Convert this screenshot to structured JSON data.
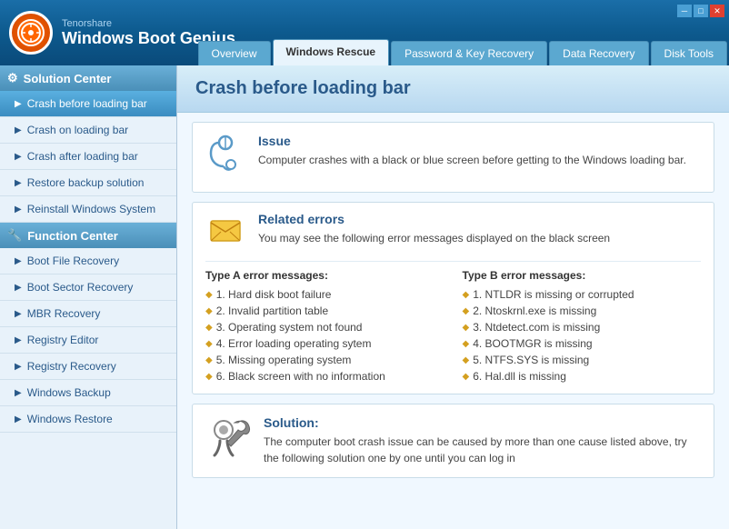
{
  "window": {
    "title": "Windows Boot Genius",
    "company": "Tenorshare",
    "min_btn": "─",
    "max_btn": "□",
    "close_btn": "✕"
  },
  "nav": {
    "tabs": [
      {
        "id": "overview",
        "label": "Overview",
        "active": false
      },
      {
        "id": "windows-rescue",
        "label": "Windows Rescue",
        "active": true
      },
      {
        "id": "password-key-recovery",
        "label": "Password & Key Recovery",
        "active": false
      },
      {
        "id": "data-recovery",
        "label": "Data Recovery",
        "active": false
      },
      {
        "id": "disk-tools",
        "label": "Disk Tools",
        "active": false
      }
    ]
  },
  "sidebar": {
    "solution_center": {
      "label": "Solution Center",
      "items": [
        {
          "id": "crash-before",
          "label": "Crash before loading bar",
          "active": true
        },
        {
          "id": "crash-on",
          "label": "Crash on loading bar",
          "active": false
        },
        {
          "id": "crash-after",
          "label": "Crash after loading bar",
          "active": false
        },
        {
          "id": "restore-backup",
          "label": "Restore backup solution",
          "active": false
        },
        {
          "id": "reinstall-windows",
          "label": "Reinstall Windows System",
          "active": false
        }
      ]
    },
    "function_center": {
      "label": "Function Center",
      "items": [
        {
          "id": "boot-file",
          "label": "Boot File Recovery",
          "active": false
        },
        {
          "id": "boot-sector",
          "label": "Boot Sector Recovery",
          "active": false
        },
        {
          "id": "mbr-recovery",
          "label": "MBR Recovery",
          "active": false
        },
        {
          "id": "registry-editor",
          "label": "Registry Editor",
          "active": false
        },
        {
          "id": "registry-recovery",
          "label": "Registry Recovery",
          "active": false
        },
        {
          "id": "windows-backup",
          "label": "Windows Backup",
          "active": false
        },
        {
          "id": "windows-restore",
          "label": "Windows Restore",
          "active": false
        }
      ]
    }
  },
  "content": {
    "title": "Crash before loading bar",
    "issue": {
      "heading": "Issue",
      "description": "Computer crashes with a black or blue screen before getting to the Windows loading bar."
    },
    "related_errors": {
      "heading": "Related errors",
      "description": "You may see the following error messages displayed on the black screen",
      "type_a": {
        "heading": "Type A error messages:",
        "items": [
          "1. Hard disk boot failure",
          "2. Invalid partition table",
          "3. Operating system not found",
          "4. Error loading operating sytem",
          "5. Missing operating system",
          "6. Black screen with no information"
        ]
      },
      "type_b": {
        "heading": "Type B error messages:",
        "items": [
          "1. NTLDR is missing or corrupted",
          "2. Ntoskrnl.exe is missing",
          "3. Ntdetect.com is missing",
          "4. BOOTMGR is missing",
          "5. NTFS.SYS is missing",
          "6. Hal.dll is missing"
        ]
      }
    },
    "solution": {
      "heading": "Solution:",
      "description": "The computer boot crash issue can be caused by more than one cause listed above, try the following solution one by one until you can log in"
    }
  }
}
